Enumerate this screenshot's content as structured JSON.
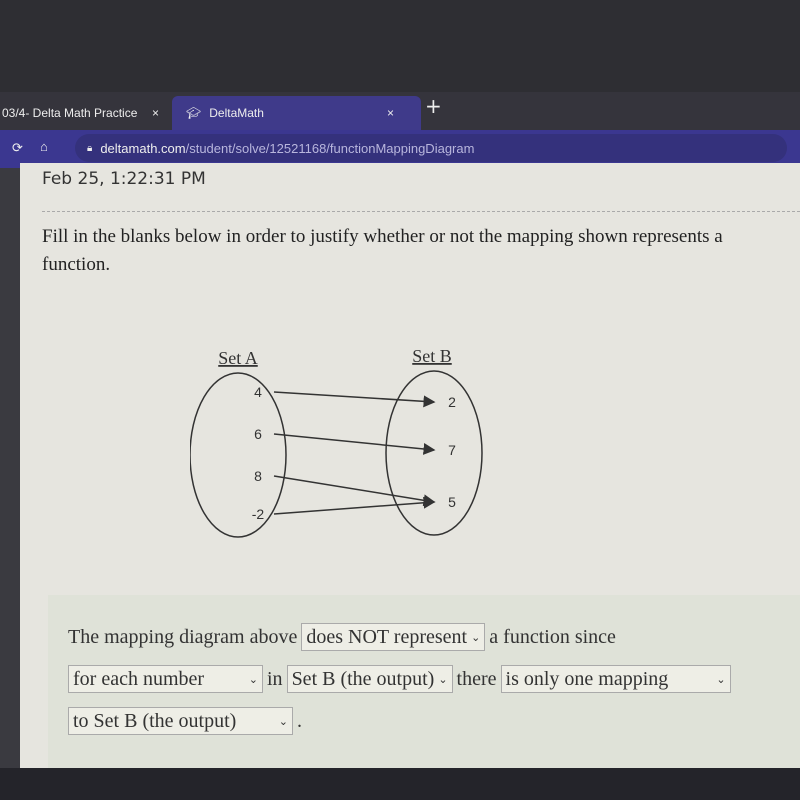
{
  "browser": {
    "tabs": [
      {
        "label": "03/4- Delta Math Practice",
        "close": "×"
      },
      {
        "label": "DeltaMath",
        "close": "×",
        "icon": "graduation-cap-icon"
      }
    ],
    "new_tab": "+",
    "url_domain": "deltamath.com",
    "url_path": "/student/solve/12521168/functionMappingDiagram"
  },
  "page": {
    "timestamp": "Feb 25, 1:22:31 PM",
    "prompt": "Fill in the blanks below in order to justify whether or not the mapping shown represents a function."
  },
  "diagram": {
    "set_a_label": "Set A",
    "set_b_label": "Set B",
    "set_a": [
      "4",
      "6",
      "8",
      "-2"
    ],
    "set_b": [
      "2",
      "7",
      "5"
    ],
    "mappings": [
      [
        "4",
        "2"
      ],
      [
        "6",
        "7"
      ],
      [
        "8",
        "5"
      ],
      [
        "-2",
        "5"
      ]
    ]
  },
  "answer": {
    "t1": "The mapping diagram above",
    "s1": "does NOT represent",
    "t2": "a function since",
    "s2": "for each number",
    "t3": "in",
    "s3": "Set B (the output)",
    "t4": "there",
    "s4": "is only one mapping",
    "s5": "to Set B (the output)",
    "t5": ".",
    "chevron": "⌄"
  }
}
